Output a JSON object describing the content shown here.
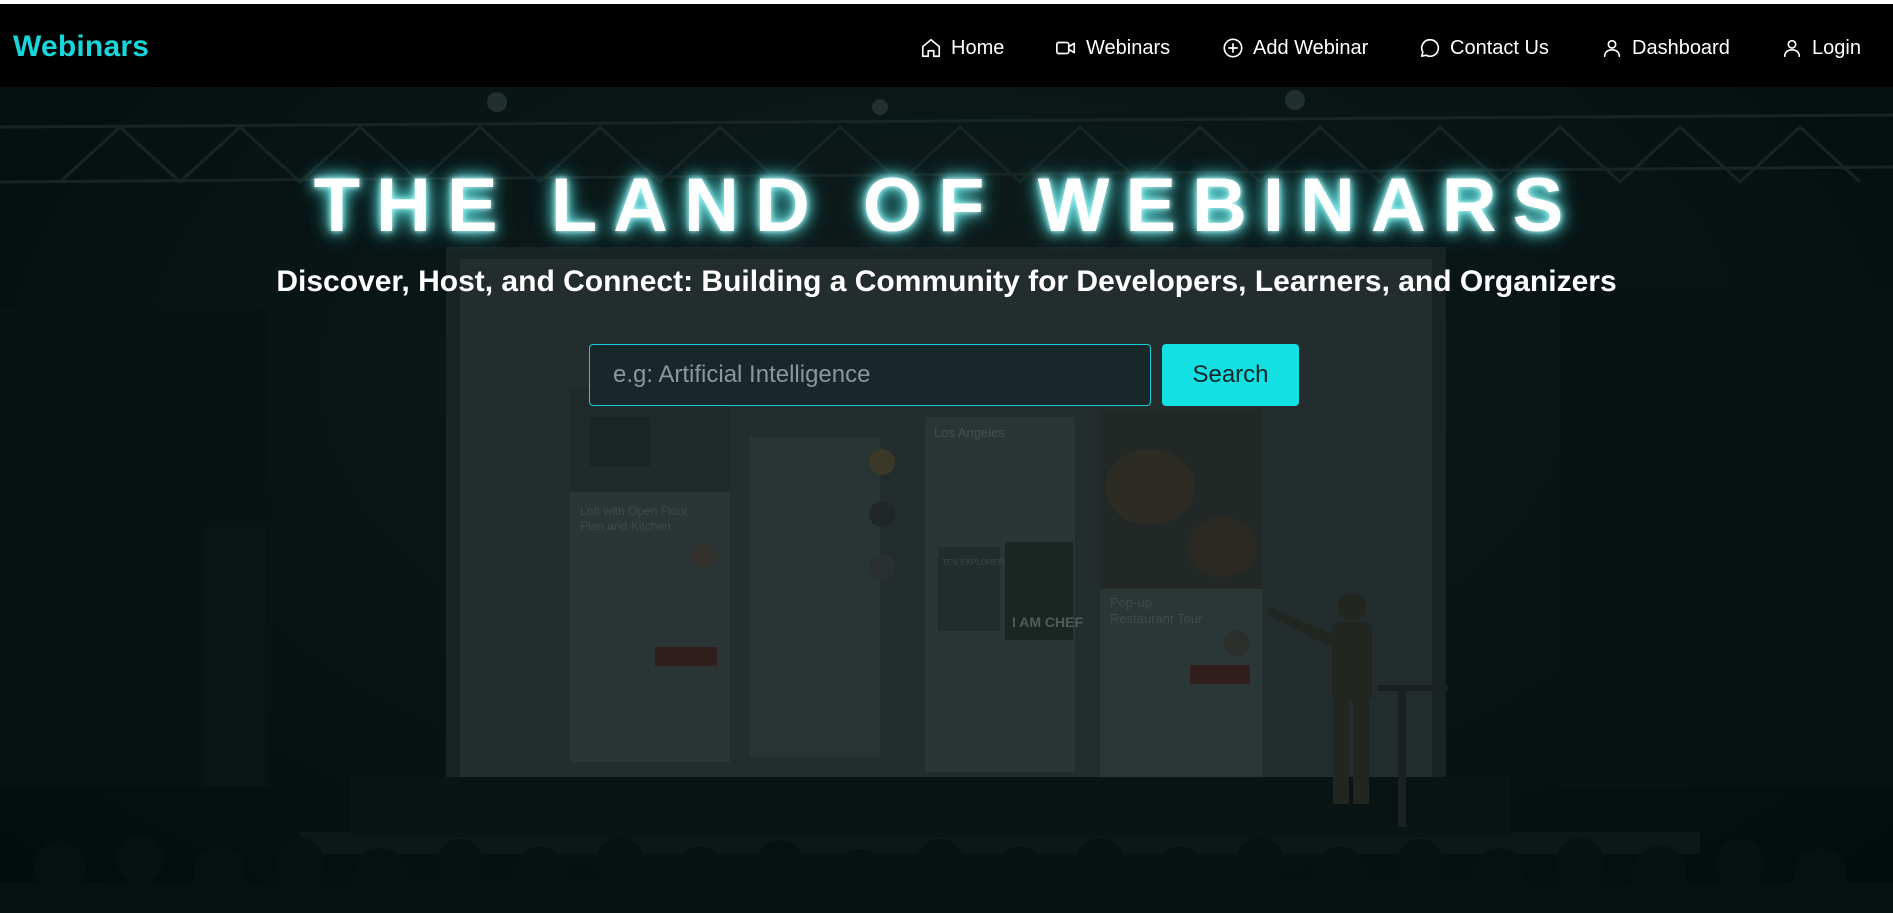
{
  "brand": "Webinars",
  "nav": {
    "home": "Home",
    "webinars": "Webinars",
    "add_webinar": "Add Webinar",
    "contact": "Contact Us",
    "dashboard": "Dashboard",
    "login": "Login"
  },
  "icons": {
    "home": "home-icon",
    "webinars": "video-camera-icon",
    "add_webinar": "plus-circle-icon",
    "contact": "chat-bubble-icon",
    "dashboard": "user-icon",
    "login": "user-icon"
  },
  "hero": {
    "title": "THE LAND OF WEBINARS",
    "subtitle": "Discover, Host, and Connect: Building a Community for Developers, Learners, and Organizers",
    "background_screen": {
      "card1_title": "Loft with Open Floor Plan and Kitchen",
      "card3_title": "Los Angeles",
      "book1_title": "TEN EXPLORERS",
      "book2_title": "I AM CHEF",
      "card4_title": "Pop-up Restaurant Tour"
    }
  },
  "search": {
    "placeholder": "e.g: Artificial Intelligence",
    "value": "",
    "button_label": "Search"
  },
  "colors": {
    "accent": "#17d7dc",
    "button": "#12e0e3",
    "navbar_bg": "#000000",
    "text": "#ffffff"
  }
}
